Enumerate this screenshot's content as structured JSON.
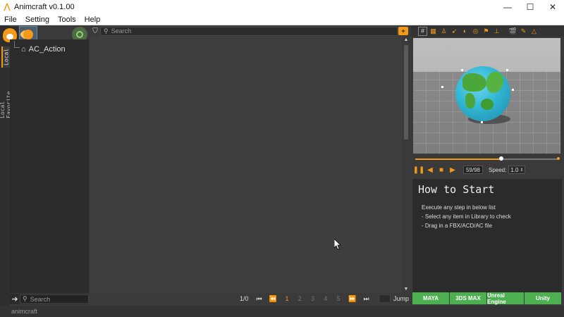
{
  "window": {
    "title": "Animcraft v0.1.00",
    "minimize": "—",
    "maximize": "☐",
    "close": "✕"
  },
  "menu": [
    "File",
    "Setting",
    "Tools",
    "Help"
  ],
  "sidebar": {
    "tabs": [
      "Local",
      "Local Favorite"
    ],
    "tree": {
      "root_label": "AC_Action"
    },
    "search_placeholder": "Search"
  },
  "library": {
    "search_placeholder": "Search",
    "pager": {
      "count": "1/0",
      "pages": [
        "1",
        "2",
        "3",
        "4",
        "5"
      ],
      "active_page": "1",
      "jump_label": "Jump"
    }
  },
  "preview": {
    "timeline_progress": 0.6,
    "frame": "59/98",
    "speed_label": "Speed:",
    "speed_value": "1.0"
  },
  "how_to_start": {
    "title": "How to Start",
    "lines": [
      "Execute any step in below list",
      "- Select any item in Library to check",
      "- Drag in a FBX/ACD/AC file"
    ]
  },
  "engines": [
    "MAYA",
    "3DS MAX",
    "Unreal Engine",
    "Unity"
  ],
  "status": {
    "text": "animcraft"
  },
  "colors": {
    "accent": "#f29a17",
    "engine_green": "#4caf50",
    "background": "#3a3a3a"
  }
}
